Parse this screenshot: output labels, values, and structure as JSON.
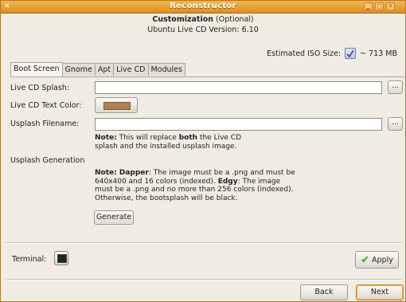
{
  "window": {
    "title": "Reconstructor",
    "controls": [
      "minimize-icon",
      "maximize-icon",
      "close-icon"
    ]
  },
  "header": {
    "title": "Customization",
    "optional": "(Optional)",
    "subtitle": "Ubuntu Live CD Version: 6.10",
    "iso_label": "Estimated ISO Size:",
    "iso_size": "~ 713 MB"
  },
  "tabs": [
    "Boot Screen",
    "Gnome",
    "Apt",
    "Live CD",
    "Modules"
  ],
  "boot_screen": {
    "splash_label": "Live CD Splash:",
    "splash_value": "",
    "text_color_label": "Live CD Text Color:",
    "text_color": "#b08050",
    "usplash_label": "Usplash Filename:",
    "usplash_value": "",
    "browse_label": "...",
    "note1_prefix": "Note:",
    "note1_text_a": "This will replace",
    "note1_bold": "both",
    "note1_text_b": "the Live CD",
    "note1_line2": "splash and the installed usplash image.",
    "gen_label": "Usplash Generation",
    "note2_prefix": "Note: Dapper",
    "note2_line1": ": The image must be a .png and must be",
    "note2_line2a": "640x400 and 16 colors (indexed).",
    "note2_edgy": "Edgy",
    "note2_line2b": ": The image",
    "note2_line3": "must be a .png and no more than 256 colors (indexed).",
    "note2_line4": "Otherwise, the bootsplash will be black.",
    "generate_label": "Generate"
  },
  "footer": {
    "terminal_label": "Terminal:",
    "apply_label": "Apply",
    "back_label": "Back",
    "next_label": "Next"
  },
  "colors": {
    "titlebar": "#e89a2e",
    "accent_check": "#4a9a2a"
  }
}
